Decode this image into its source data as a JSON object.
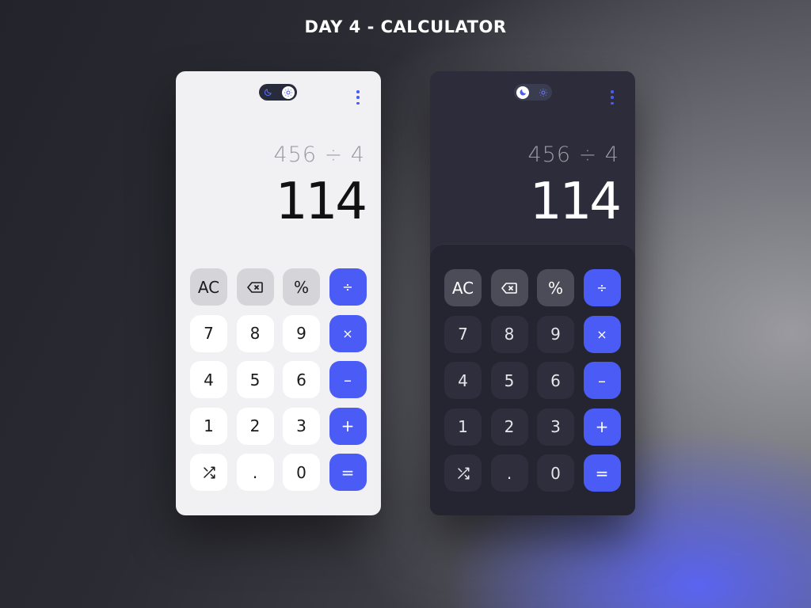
{
  "page": {
    "title": "DAY 4 - CALCULATOR"
  },
  "colors": {
    "accent": "#4a5cf5",
    "light_bg": "#f1f1f3",
    "dark_bg": "#2c2c3a"
  },
  "theme_toggle": {
    "moon_icon": "moon-icon",
    "sun_icon": "sun-icon"
  },
  "menu": {
    "icon": "more-vertical-icon"
  },
  "light": {
    "expression": "456 ÷ 4",
    "result": "114"
  },
  "dark": {
    "expression": "456 ÷ 4",
    "result": "114"
  },
  "keys": {
    "ac": "AC",
    "backspace_icon": "backspace-icon",
    "percent": "%",
    "divide": "÷",
    "seven": "7",
    "eight": "8",
    "nine": "9",
    "multiply": "×",
    "four": "4",
    "five": "5",
    "six": "6",
    "minus": "–",
    "one": "1",
    "two": "2",
    "three": "3",
    "plus": "+",
    "shuffle_icon": "shuffle-icon",
    "dot": ".",
    "zero": "0",
    "equals": "="
  }
}
